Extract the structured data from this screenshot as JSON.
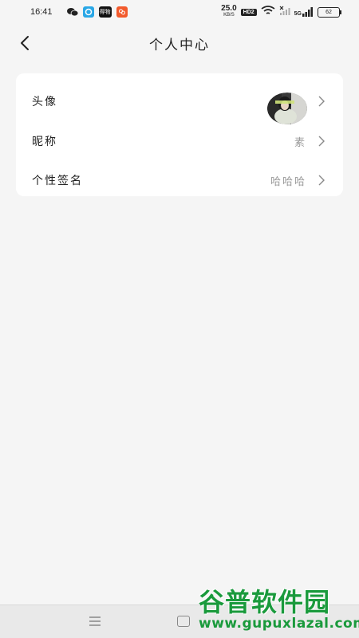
{
  "status_bar": {
    "time": "16:41",
    "app_icons": [
      "wechat-icon",
      "browser-icon",
      "weibo-icon",
      "app-icon"
    ],
    "black_app_label": "得物",
    "network_speed": "25.0",
    "network_unit": "KB/S",
    "hd_badge": "HD2",
    "signal_label": "5G",
    "battery": "62"
  },
  "header": {
    "title": "个人中心",
    "back_icon": "chevron-left-icon"
  },
  "profile": {
    "rows": [
      {
        "label": "头像",
        "value": ""
      },
      {
        "label": "昵称",
        "value": "素"
      },
      {
        "label": "个性签名",
        "value": "哈哈哈"
      }
    ]
  },
  "nav_bar": {
    "menu_icon": "menu-icon",
    "home_icon": "home-icon"
  },
  "watermark": {
    "title": "谷普软件园",
    "url": "www.gupuxlazal.com"
  },
  "colors": {
    "background": "#f5f5f5",
    "card": "#ffffff",
    "value_text": "#999999",
    "watermark": "#1a9a3c"
  }
}
